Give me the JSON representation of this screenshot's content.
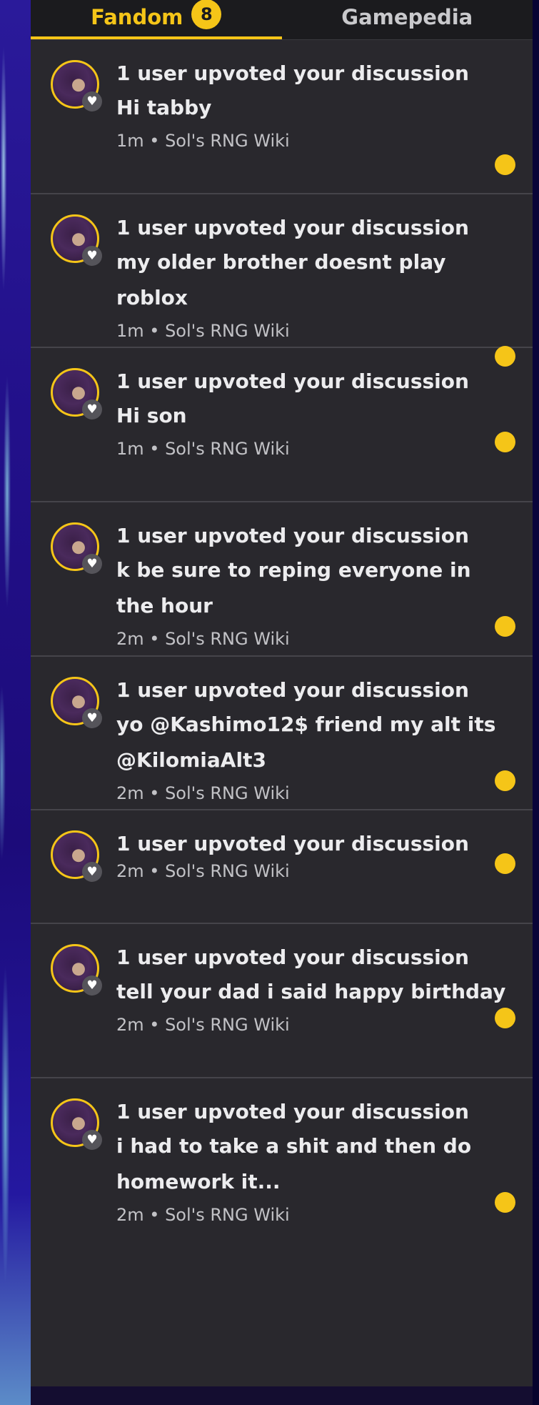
{
  "tabs": [
    {
      "label": "Fandom",
      "badge": "8",
      "active": true
    },
    {
      "label": "Gamepedia",
      "active": false
    }
  ],
  "colors": {
    "accent": "#f5c518",
    "panel": "#29282d",
    "text": "#ececee"
  },
  "notifications": [
    {
      "title": "1 user upvoted your discussion",
      "snippet": "Hi tabby",
      "meta": "1m • Sol's RNG Wiki",
      "unread": true
    },
    {
      "title": "1 user upvoted your discussion",
      "snippet": "my older brother doesnt play roblox",
      "meta": "1m • Sol's RNG Wiki",
      "unread": true
    },
    {
      "title": "1 user upvoted your discussion",
      "snippet": "Hi son",
      "meta": "1m • Sol's RNG Wiki",
      "unread": true
    },
    {
      "title": "1 user upvoted your discussion",
      "snippet": "k be sure to reping everyone in the hour",
      "meta": "2m • Sol's RNG Wiki",
      "unread": true
    },
    {
      "title": "1 user upvoted your discussion",
      "snippet": "yo @Kashimo12$ friend my alt its @KilomiaAlt3",
      "meta": "2m • Sol's RNG Wiki",
      "unread": true
    },
    {
      "title": "1 user upvoted your discussion",
      "snippet": "",
      "meta": "2m • Sol's RNG Wiki",
      "unread": true
    },
    {
      "title": "1 user upvoted your discussion",
      "snippet": "tell your dad i said happy birthday",
      "meta": "2m • Sol's RNG Wiki",
      "unread": true
    },
    {
      "title": "1 user upvoted your discussion",
      "snippet": "i had to take a shit and then do homework it...",
      "meta": "2m • Sol's RNG Wiki",
      "unread": true
    }
  ]
}
